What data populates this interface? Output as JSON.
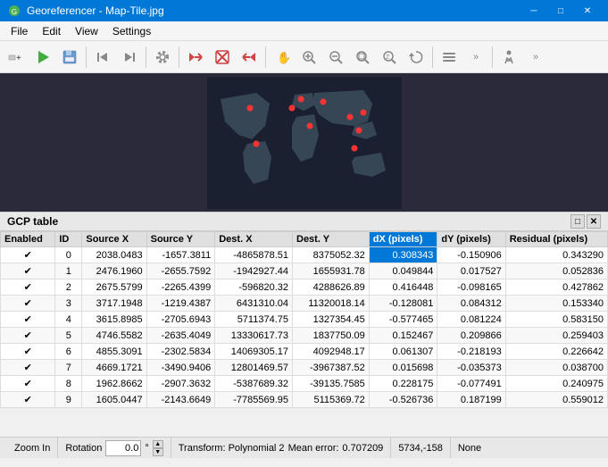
{
  "window": {
    "title": "Georeferencer - Map-Tile.jpg",
    "app_icon": "⊞"
  },
  "menu": {
    "items": [
      "File",
      "Edit",
      "View",
      "Settings"
    ]
  },
  "toolbar": {
    "buttons": [
      {
        "name": "add-point",
        "icon": "✛",
        "label": "Add Point"
      },
      {
        "name": "play",
        "icon": "▶",
        "label": "Play"
      },
      {
        "name": "save",
        "icon": "💾",
        "label": "Save"
      },
      {
        "name": "move-left",
        "icon": "◁",
        "label": "Move Left"
      },
      {
        "name": "move-right",
        "icon": "▷",
        "label": "Move Right"
      },
      {
        "name": "settings",
        "icon": "⚙",
        "label": "Settings"
      },
      {
        "name": "delete",
        "icon": "✕",
        "label": "Delete"
      },
      {
        "name": "delete2",
        "icon": "✕",
        "label": "Delete2"
      },
      {
        "name": "delete3",
        "icon": "✕",
        "label": "Delete3"
      },
      {
        "name": "pan",
        "icon": "✋",
        "label": "Pan"
      },
      {
        "name": "zoom-in",
        "icon": "🔍+",
        "label": "Zoom In"
      },
      {
        "name": "zoom-out",
        "icon": "🔍-",
        "label": "Zoom Out"
      },
      {
        "name": "zoom-fit",
        "icon": "⊡",
        "label": "Zoom Fit"
      },
      {
        "name": "zoom-select",
        "icon": "⊞",
        "label": "Zoom Select"
      },
      {
        "name": "refresh",
        "icon": "↺",
        "label": "Refresh"
      },
      {
        "name": "tool1",
        "icon": "≋",
        "label": "Tool1"
      },
      {
        "name": "more",
        "icon": "»",
        "label": "More"
      },
      {
        "name": "figurine",
        "icon": "🧍",
        "label": "Figurine"
      },
      {
        "name": "more2",
        "icon": "»",
        "label": "More2"
      }
    ]
  },
  "gcp_section": {
    "title": "GCP table",
    "table": {
      "columns": [
        "Enabled",
        "ID",
        "Source X",
        "Source Y",
        "Dest. X",
        "Dest. Y",
        "dX (pixels)",
        "dY (pixels)",
        "Residual (pixels)"
      ],
      "rows": [
        {
          "enabled": true,
          "id": 0,
          "source_x": "2038.0483",
          "source_y": "-1657.3811",
          "dest_x": "-4865878.51",
          "dest_y": "8375052.32",
          "dx": "0.308343",
          "dy": "-0.150906",
          "residual": "0.343290"
        },
        {
          "enabled": true,
          "id": 1,
          "source_x": "2476.1960",
          "source_y": "-2655.7592",
          "dest_x": "-1942927.44",
          "dest_y": "1655931.78",
          "dx": "0.049844",
          "dy": "0.017527",
          "residual": "0.052836"
        },
        {
          "enabled": true,
          "id": 2,
          "source_x": "2675.5799",
          "source_y": "-2265.4399",
          "dest_x": "-596820.32",
          "dest_y": "4288626.89",
          "dx": "0.416448",
          "dy": "-0.098165",
          "residual": "0.427862"
        },
        {
          "enabled": true,
          "id": 3,
          "source_x": "3717.1948",
          "source_y": "-1219.4387",
          "dest_x": "6431310.04",
          "dest_y": "11320018.14",
          "dx": "-0.128081",
          "dy": "0.084312",
          "residual": "0.153340"
        },
        {
          "enabled": true,
          "id": 4,
          "source_x": "3615.8985",
          "source_y": "-2705.6943",
          "dest_x": "5711374.75",
          "dest_y": "1327354.45",
          "dx": "-0.577465",
          "dy": "0.081224",
          "residual": "0.583150"
        },
        {
          "enabled": true,
          "id": 5,
          "source_x": "4746.5582",
          "source_y": "-2635.4049",
          "dest_x": "13330617.73",
          "dest_y": "1837750.09",
          "dx": "0.152467",
          "dy": "0.209866",
          "residual": "0.259403"
        },
        {
          "enabled": true,
          "id": 6,
          "source_x": "4855.3091",
          "source_y": "-2302.5834",
          "dest_x": "14069305.17",
          "dest_y": "4092948.17",
          "dx": "0.061307",
          "dy": "-0.218193",
          "residual": "0.226642"
        },
        {
          "enabled": true,
          "id": 7,
          "source_x": "4669.1721",
          "source_y": "-3490.9406",
          "dest_x": "12801469.57",
          "dest_y": "-3967387.52",
          "dx": "0.015698",
          "dy": "-0.035373",
          "residual": "0.038700"
        },
        {
          "enabled": true,
          "id": 8,
          "source_x": "1962.8662",
          "source_y": "-2907.3632",
          "dest_x": "-5387689.32",
          "dest_y": "-39135.7585",
          "dx": "0.228175",
          "dy": "-0.077491",
          "residual": "0.240975"
        },
        {
          "enabled": true,
          "id": 9,
          "source_x": "1605.0447",
          "source_y": "-2143.6649",
          "dest_x": "-7785569.95",
          "dest_y": "5115369.72",
          "dx": "-0.526736",
          "dy": "0.187199",
          "residual": "0.559012"
        }
      ],
      "highlighted_column": "dX (pixels)",
      "highlighted_row": 0
    }
  },
  "status_bar": {
    "zoom_label": "Zoom In",
    "rotation_label": "Rotation",
    "rotation_value": "0.0",
    "rotation_unit": "°",
    "transform_label": "Transform: Polynomial 2",
    "mean_error_label": "Mean error:",
    "mean_error_value": "0.707209",
    "coords": "5734,-158",
    "crs": "None"
  },
  "source_label_1": "Source",
  "source_label_2": "Source"
}
